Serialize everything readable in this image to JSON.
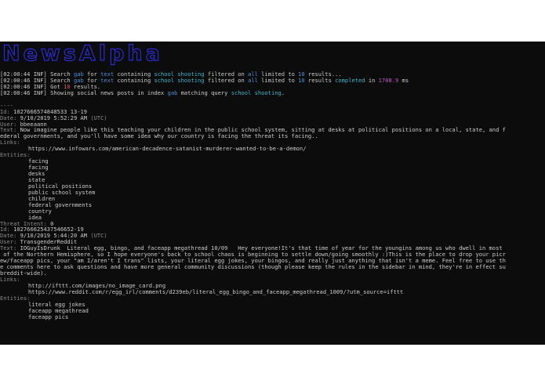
{
  "banner": "NewsAlpha",
  "log": [
    {
      "time": "[02:00:44 INF]",
      "segs": [
        [
          "Search ",
          ""
        ],
        [
          "gab",
          "blue"
        ],
        [
          " for ",
          ""
        ],
        [
          "text",
          "blue"
        ],
        [
          " containing ",
          ""
        ],
        [
          "school shooting",
          "cyan"
        ],
        [
          " filtered on ",
          ""
        ],
        [
          "all",
          "blue"
        ],
        [
          " limited to ",
          ""
        ],
        [
          "10",
          "blue"
        ],
        [
          " results...",
          ""
        ]
      ]
    },
    {
      "time": "[02:00:46 INF]",
      "segs": [
        [
          "Search ",
          ""
        ],
        [
          "gab",
          "blue"
        ],
        [
          " for ",
          ""
        ],
        [
          "text",
          "blue"
        ],
        [
          " containing ",
          ""
        ],
        [
          "school shooting",
          "cyan"
        ],
        [
          " filtered on ",
          ""
        ],
        [
          "all",
          "blue"
        ],
        [
          " limited to ",
          ""
        ],
        [
          "10",
          "blue"
        ],
        [
          " results ",
          ""
        ],
        [
          "completed",
          "cyan"
        ],
        [
          " in ",
          ""
        ],
        [
          "1708.9",
          "magenta"
        ],
        [
          " ms",
          ""
        ]
      ]
    },
    {
      "time": "[02:00:46 INF]",
      "segs": [
        [
          "Got ",
          ""
        ],
        [
          "10",
          "red"
        ],
        [
          " results.",
          ""
        ]
      ]
    },
    {
      "time": "[02:00:46 INF]",
      "segs": [
        [
          "Showing social news posts in index ",
          ""
        ],
        [
          "gab",
          "blue"
        ],
        [
          " matching query ",
          ""
        ],
        [
          "school shooting",
          "cyan"
        ],
        [
          ".",
          ""
        ]
      ]
    }
  ],
  "posts": [
    {
      "separator": "----",
      "id_label": "Id:",
      "id": "1027666574848533 13-19",
      "date_label": "Date:",
      "date": "9/10/2019 5:52:29 AM",
      "tz": "(UTC)",
      "user_label": "User:",
      "user": "bbeeaann",
      "text_label": "Text:",
      "text_lines": [
        "Now imagine people like this teaching your children in the public school system, sitting at desks at political positions on a local, state, and f",
        "ederal governments, and you'll have some idea why our country is facing the threat its facing.."
      ],
      "links_label": "Links:",
      "links": [
        "https://www.infowars.com/american-decadence-satanist-murderer-wanted-to-be-a-demon/"
      ],
      "entities_label": "Entities:",
      "entities": [
        "facing",
        "facing",
        "desks",
        "state",
        "political positions",
        "public school system",
        "children",
        "federal governments",
        "country",
        "idea"
      ],
      "threat_label": "Threat Intent:",
      "threat": "0"
    },
    {
      "separator": "",
      "id_label": "Id:",
      "id": "102766625437546652-19",
      "date_label": "Date:",
      "date": "9/10/2019 5:44:20 AM",
      "tz": "(UTC)",
      "user_label": "User:",
      "user": "TransgenderReddit",
      "text_label": "Text:",
      "text_lines": [
        "IOGuyIsDrunk  Literal egg, bingo, and faceapp megathread 10/09   Hey everyone!It's that time of year for the youngins among us who dwell in most",
        " of the Northern Hemisphere, so I hope everyone's back to school chaos is beginning to settle down/going smoothly :)This is the place to drop your picr",
        "ew/faceapp pics, your \"am I/aren't I trans\" lists, your literal egg jokes, your bingos, and really just anything that isn't a meme. Feel free to use th",
        "e comments here to ask questions and have more general community discussions (though please keep the rules in the sidebar in mind, they're in effect su",
        "breddit-wide)."
      ],
      "links_label": "Links:",
      "links": [
        "http://ifttt.com/images/no_image_card.png",
        "https://www.reddit.com/r/egg_irl/comments/d239eb/literal_egg_bingo_and_faceapp_megathread_1009/?utm_source=ifttt"
      ],
      "entities_label": "Entities:",
      "entities": [
        "literal egg jokes",
        "faceapp megathread",
        "faceapp pics"
      ]
    }
  ]
}
